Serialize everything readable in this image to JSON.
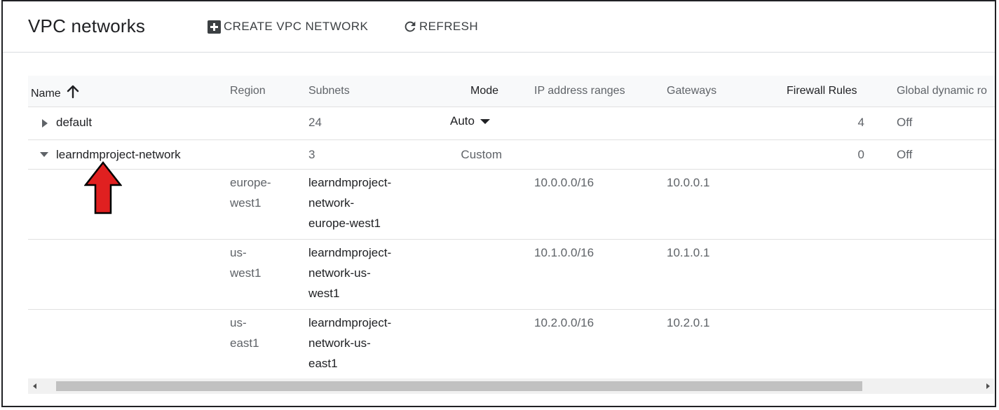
{
  "header": {
    "title": "VPC networks",
    "create_label": "CREATE VPC NETWORK",
    "refresh_label": "REFRESH"
  },
  "table": {
    "columns": {
      "name": "Name",
      "region": "Region",
      "subnets": "Subnets",
      "mode": "Mode",
      "ip_ranges": "IP address ranges",
      "gateways": "Gateways",
      "firewall_rules": "Firewall Rules",
      "global_dynamic_routing": "Global dynamic ro"
    },
    "networks": [
      {
        "name": "default",
        "subnets": "24",
        "mode": "Auto",
        "firewall_rules": "4",
        "global_dynamic_routing": "Off",
        "expanded": false
      },
      {
        "name": "learndmproject-network",
        "subnets": "3",
        "mode": "Custom",
        "firewall_rules": "0",
        "global_dynamic_routing": "Off",
        "expanded": true
      }
    ],
    "subnets": [
      {
        "region_lines": [
          "europe-",
          "west1"
        ],
        "name_lines": [
          "learndmproject-",
          "network-",
          "europe-west1"
        ],
        "ip_range": "10.0.0.0/16",
        "gateway": "10.0.0.1"
      },
      {
        "region_lines": [
          "us-",
          "west1"
        ],
        "name_lines": [
          "learndmproject-",
          "network-us-",
          "west1"
        ],
        "ip_range": "10.1.0.0/16",
        "gateway": "10.1.0.1"
      },
      {
        "region_lines": [
          "us-",
          "east1"
        ],
        "name_lines": [
          "learndmproject-",
          "network-us-",
          "east1"
        ],
        "ip_range": "10.2.0.0/16",
        "gateway": "10.2.0.1"
      }
    ]
  },
  "icons": {
    "create": "add-box-icon",
    "refresh": "refresh-icon",
    "sort": "arrow-up-icon",
    "collapsed": "caret-right-icon",
    "expanded": "caret-down-icon",
    "annotation": "red-arrow-up-icon"
  },
  "colors": {
    "annotation_arrow": "#e02020",
    "text_primary": "#202124",
    "text_secondary": "#5f6368"
  }
}
